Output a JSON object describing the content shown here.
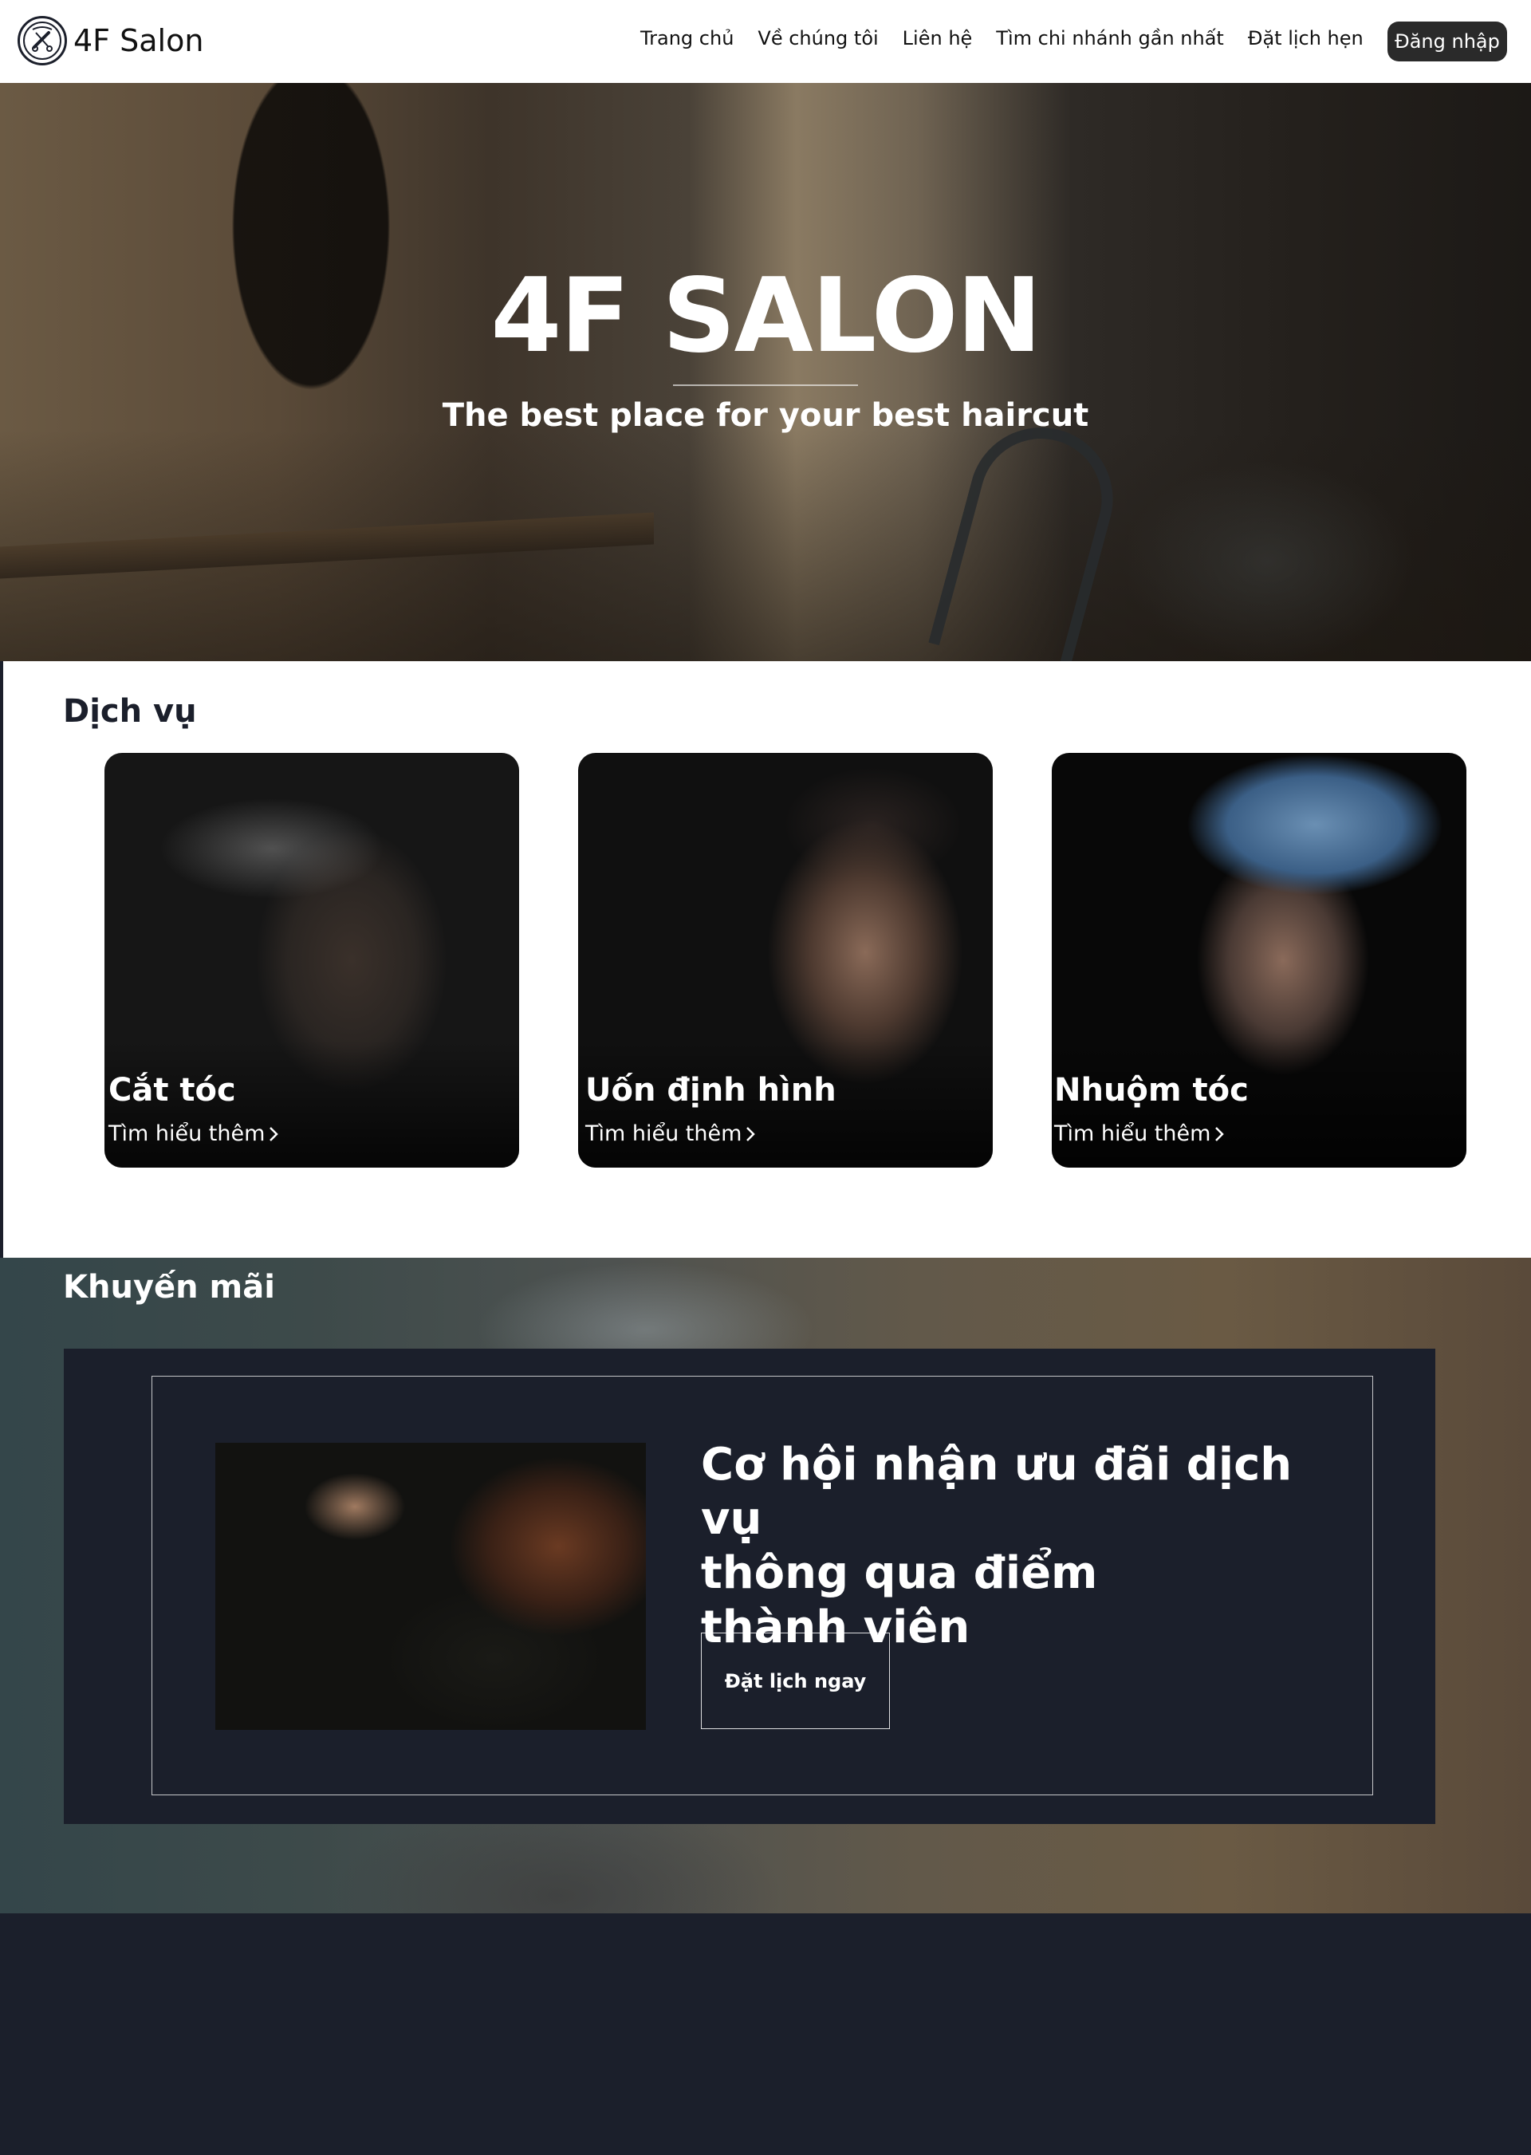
{
  "nav": {
    "brand": "4F Salon",
    "links": [
      "Trang chủ",
      "Về chúng tôi",
      "Liên hệ",
      "Tìm chi nhánh gần nhất",
      "Đặt lịch hẹn"
    ],
    "login_label": "Đăng nhập"
  },
  "hero": {
    "title": "4F SALON",
    "subtitle": "The best place for your best haircut"
  },
  "services": {
    "title": "Dịch vụ",
    "cards": [
      {
        "title": "Cắt tóc",
        "link": "Tìm hiểu thêm"
      },
      {
        "title": "Uốn định hình",
        "link": "Tìm hiểu thêm"
      },
      {
        "title": "Nhuộm tóc",
        "link": "Tìm hiểu thêm"
      }
    ]
  },
  "promotions": {
    "title": "Khuyến mãi",
    "heading_lines": [
      "Cơ hội nhận ưu đãi dịch vụ",
      "thông qua điểm",
      "thành viên"
    ],
    "button_label": "Đặt lịch ngay"
  },
  "icons": {
    "logo": "barber-logo-icon",
    "card_link_arrow": "chevron-right-icon"
  },
  "colors": {
    "dark_navy": "#1b1f2b",
    "login_button": "#2a2a2a",
    "white": "#ffffff"
  }
}
